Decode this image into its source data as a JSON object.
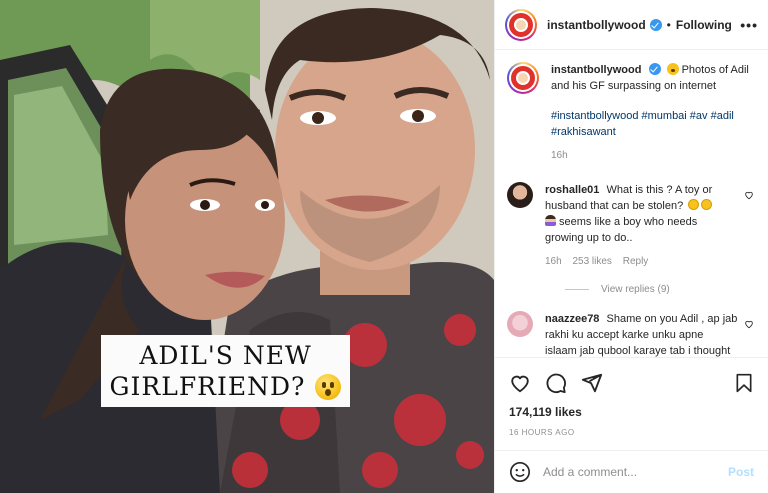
{
  "post": {
    "username": "instantbollywood",
    "follow_state": "Following",
    "more_label": "•••",
    "separator": "•"
  },
  "photo": {
    "caption_line1": "ADIL'S NEW",
    "caption_line2": "GIRLFRIEND?"
  },
  "caption": {
    "username": "instantbollywood",
    "text": "Photos of Adil and his GF surpassing on internet",
    "hashtags": "#instantbollywood #mumbai #av #adil #rakhisawant",
    "age": "16h"
  },
  "comments": [
    {
      "username": "roshalle01",
      "text_part1": "What is this ? A toy or husband that can be stolen?",
      "text_part2": "seems like a boy who needs growing up to do..",
      "age": "16h",
      "likes": "253 likes",
      "reply": "Reply",
      "view_replies": "View replies (9)"
    },
    {
      "username": "naazzee78",
      "text": "Shame on you Adil , ap jab rakhi ku accept karke unku apne islaam jab qubool karaye tab i thought u r a true Muslim and you"
    }
  ],
  "stats": {
    "likes": "174,119 likes",
    "time": "16 HOURS AGO"
  },
  "composer": {
    "placeholder": "Add a comment...",
    "post_label": "Post"
  },
  "colors": {
    "link": "#00376b",
    "verified": "#3897f0",
    "post_disabled": "#b2dffc"
  }
}
